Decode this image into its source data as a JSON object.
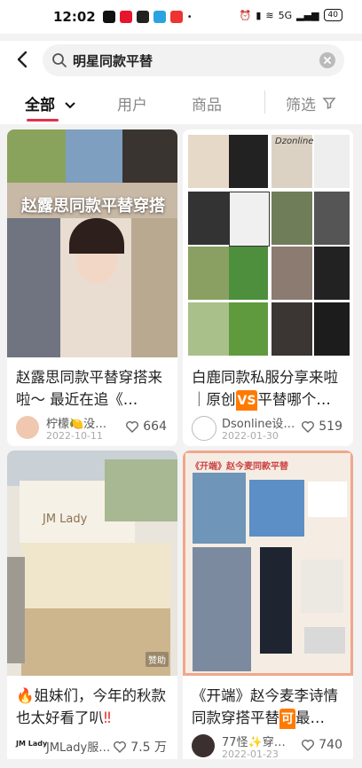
{
  "status": {
    "time": "12:02",
    "battery": "40",
    "network": "5G"
  },
  "search": {
    "query": "明星同款平替"
  },
  "tabs": [
    {
      "label": "全部"
    },
    {
      "label": "用户"
    },
    {
      "label": "商品"
    },
    {
      "label": "筛选"
    }
  ],
  "cards": [
    {
      "overlay": "赵露思同款平替穿搭",
      "title": "赵露思同款平替穿搭来啦～ 最近在追《…",
      "author": "柠檬🍋没…",
      "date": "2022-10-11",
      "likes": "664"
    },
    {
      "overlay": "Dzonline",
      "title_a": "白鹿同款私服分享来啦｜原创",
      "tag": "VS",
      "title_b": "平替哪个…",
      "author": "Dsonline设…",
      "date": "2022-01-30",
      "likes": "519"
    },
    {
      "overlay": "JM Lady",
      "title_a": "姐妹们，今年的秋款也太好看了叭",
      "author": "JMLady服…",
      "date": "",
      "likes": "7.5 万",
      "avatar_text": "JM Lady"
    },
    {
      "overlay": "《开端》赵今麦同款平替",
      "title_a": "《开端》赵今麦李诗情同款穿搭平替",
      "tag": "可",
      "title_b": "最…",
      "author": "77怪✨穿…",
      "date": "2022-01-23",
      "likes": "740"
    }
  ],
  "colors": {
    "accent": "#e2304a",
    "tag": "#ff7a00"
  }
}
